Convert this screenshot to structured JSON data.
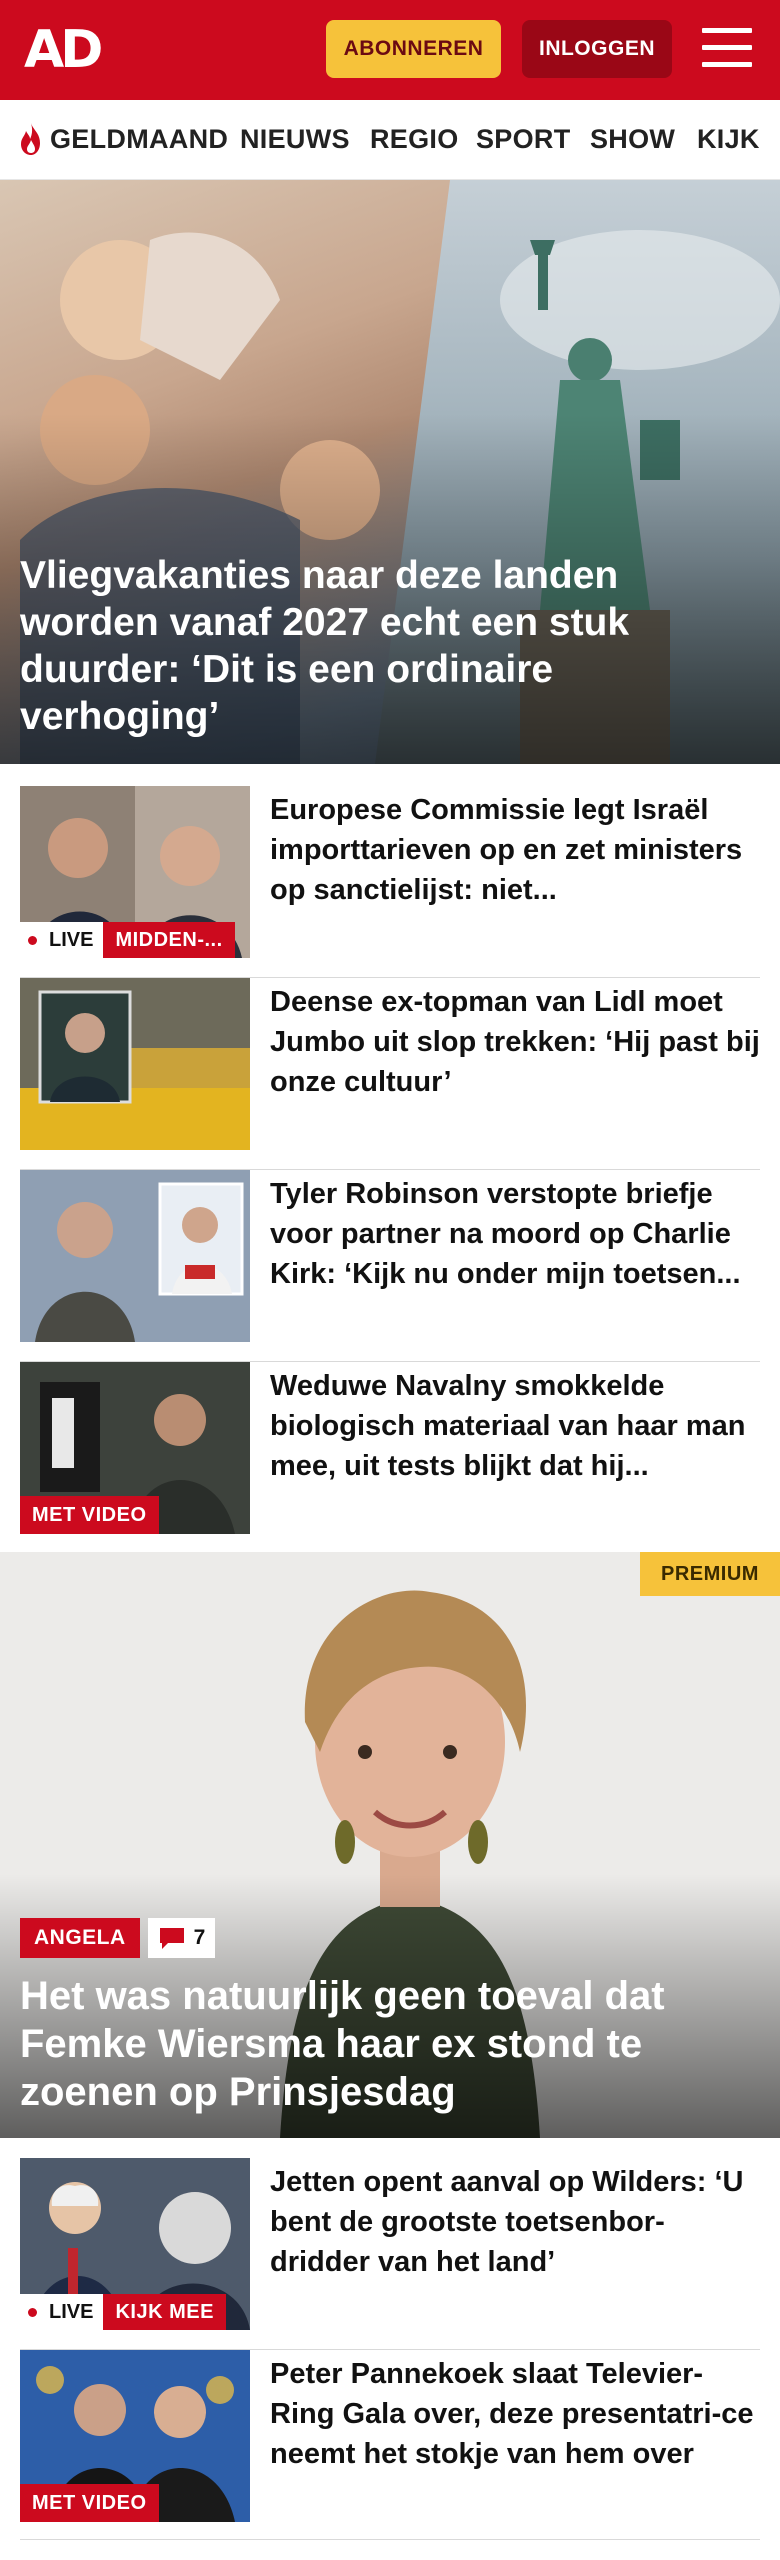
{
  "header": {
    "logo": "AD",
    "subscribe_label": "ABONNEREN",
    "login_label": "INLOGGEN"
  },
  "nav": {
    "items": [
      "GELDMAAND",
      "NIEUWS",
      "REGIO",
      "SPORT",
      "SHOW",
      "KIJK"
    ]
  },
  "hero": {
    "title": "Vliegvakanties naar deze landen worden vanaf 2027 echt een stuk duurder: ‘Dit is een ordinaire verhoging’"
  },
  "articles": [
    {
      "title": "Europese Commissie legt Israël importtarieven op en zet ministers op sanctielijst: niet...",
      "live_label": "LIVE",
      "tag": "MIDDEN-..."
    },
    {
      "title": "Deense ex-topman van Lidl moet Jumbo uit slop trekken: ‘Hij past bij onze cultuur’"
    },
    {
      "title": "Tyler Robinson verstopte briefje voor partner na moord op Charlie Kirk: ‘Kijk nu onder mijn toetsen..."
    },
    {
      "title": "Weduwe Navalny smokkelde biologisch materiaal van haar man mee, uit tests blijkt dat hij...",
      "video_tag": "MET VIDEO"
    }
  ],
  "premium_article": {
    "badge": "PREMIUM",
    "tag": "ANGELA",
    "comment_count": "7",
    "title": "Het was natuurlijk geen toeval dat Femke Wiersma haar ex stond te zoenen op Prinsjesdag"
  },
  "articles_bottom": [
    {
      "title": "Jetten opent aanval op Wilders: ‘U bent de grootste toetsenbor-dridder van het land’",
      "live_label": "LIVE",
      "tag": "KIJK MEE"
    },
    {
      "title": "Peter Pannekoek slaat Televier-Ring Gala over, deze presentatri-ce neemt het stokje van hem over",
      "video_tag": "MET VIDEO"
    }
  ],
  "colors": {
    "brand_red": "#cc0a1e",
    "subscribe_yellow": "#f6c23a",
    "login_dark_red": "#9a0716"
  }
}
